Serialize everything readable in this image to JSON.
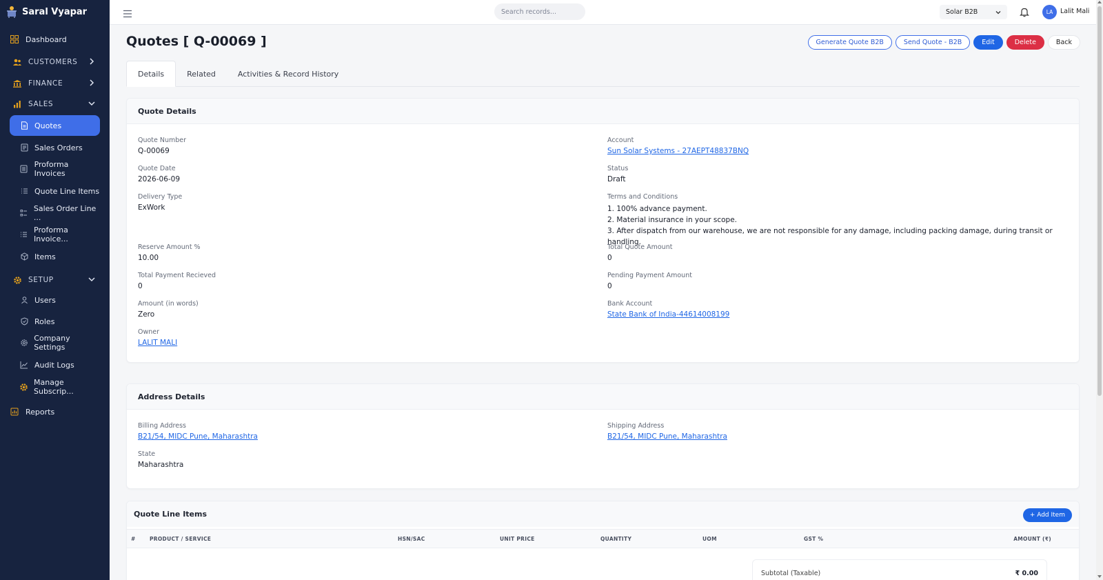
{
  "app": {
    "name": "Saral Vyapar"
  },
  "sidebar": {
    "dashboard": "Dashboard",
    "customers": "CUSTOMERS",
    "finance": "FINANCE",
    "sales": "SALES",
    "sales_items": [
      "Quotes",
      "Sales Orders",
      "Proforma Invoices",
      "Quote Line Items",
      "Sales Order Line ...",
      "Proforma Invoice...",
      "Items"
    ],
    "setup": "SETUP",
    "setup_items": [
      "Users",
      "Roles",
      "Company Settings",
      "Audit Logs",
      "Manage Subscrip..."
    ],
    "reports": "Reports"
  },
  "topbar": {
    "search_placeholder": "Search records...",
    "org": "Solar B2B",
    "avatar_initials": "LA",
    "user_name": "Lalit Mali"
  },
  "page": {
    "title": "Quotes [ Q-00069 ]",
    "actions": {
      "generate": "Generate Quote B2B",
      "send": "Send Quote - B2B",
      "edit": "Edit",
      "delete": "Delete",
      "back": "Back"
    },
    "tabs": [
      "Details",
      "Related",
      "Activities & Record History"
    ]
  },
  "quote_details": {
    "header": "Quote Details",
    "quote_number": {
      "label": "Quote Number",
      "value": "Q-00069"
    },
    "quote_date": {
      "label": "Quote Date",
      "value": "2026-06-09"
    },
    "delivery_type": {
      "label": "Delivery Type",
      "value": "ExWork"
    },
    "reserve_amount": {
      "label": "Reserve Amount %",
      "value": "10.00"
    },
    "total_payment": {
      "label": "Total Payment Recieved",
      "value": "0"
    },
    "amount_words": {
      "label": "Amount (in words)",
      "value": "Zero"
    },
    "owner": {
      "label": "Owner",
      "value": "LALIT MALI"
    },
    "account": {
      "label": "Account",
      "value": "Sun Solar Systems - 27AEPT48837BNQ"
    },
    "status": {
      "label": "Status",
      "value": "Draft"
    },
    "terms": {
      "label": "Terms and Conditions",
      "lines": [
        "1. 100% advance payment.",
        "2. Material insurance in your scope.",
        "3. After dispatch from our warehouse, we are not responsible for any damage, including packing damage, during transit or handling."
      ]
    },
    "total_quote": {
      "label": "Total Quote Amount",
      "value": "0"
    },
    "pending_payment": {
      "label": "Pending Payment Amount",
      "value": "0"
    },
    "bank_account": {
      "label": "Bank Account",
      "value": "State Bank of India-44614008199"
    }
  },
  "address_details": {
    "header": "Address Details",
    "billing": {
      "label": "Billing Address",
      "value": "B21/54, MIDC Pune, Maharashtra"
    },
    "shipping": {
      "label": "Shipping Address",
      "value": "B21/54, MIDC Pune, Maharashtra"
    },
    "state": {
      "label": "State",
      "value": "Maharashtra"
    }
  },
  "line_items": {
    "header": "Quote Line Items",
    "add_button": "+ Add Item",
    "columns": [
      "#",
      "PRODUCT / SERVICE",
      "HSN/SAC",
      "UNIT PRICE",
      "QUANTITY",
      "UOM",
      "GST %",
      "AMOUNT (₹)"
    ],
    "subtotal_label": "Subtotal (Taxable)",
    "subtotal_value": "₹ 0.00"
  },
  "colors": {
    "sidebar_bg": "#17233f",
    "accent": "#1f66e5",
    "danger": "#dc2f45",
    "active_nav": "#3f6ee8",
    "section_icon": "#e7a21c"
  }
}
